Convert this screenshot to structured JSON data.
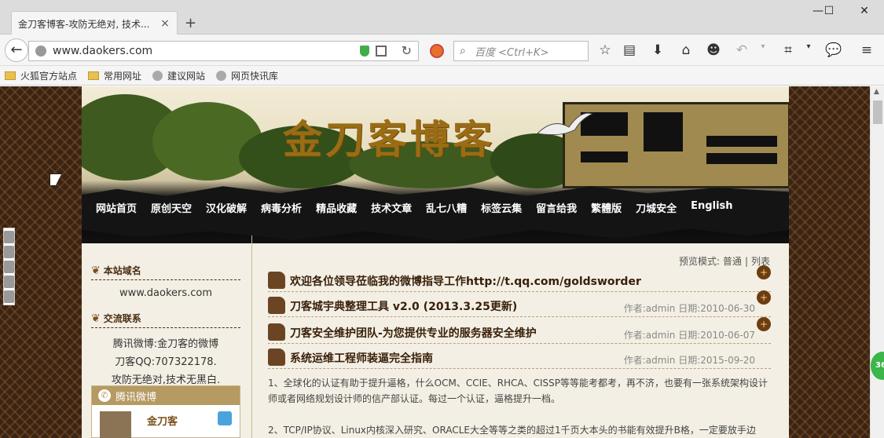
{
  "browser": {
    "tab_title": "金刀客博客-攻防无绝对, 技术...",
    "tab_close": "×",
    "new_tab": "+",
    "url": "www.daokers.com",
    "search_placeholder": "百度 <Ctrl+K>",
    "window_controls": {
      "minimize": "—",
      "maximize": "☐",
      "close": "✕"
    }
  },
  "bookmarks": [
    {
      "label": "火狐官方站点",
      "icon": "folder-icon"
    },
    {
      "label": "常用网址",
      "icon": "folder-icon"
    },
    {
      "label": "建议网站",
      "icon": "globe-icon"
    },
    {
      "label": "网页快讯库",
      "icon": "globe-icon"
    }
  ],
  "site": {
    "logo": "金刀客博客",
    "nav": [
      "网站首页",
      "原创天空",
      "汉化破解",
      "病毒分析",
      "精品收藏",
      "技术文章",
      "乱七八糟",
      "标签云集",
      "留言给我",
      "繁體版",
      "刀城安全",
      "English"
    ]
  },
  "sidebar": {
    "domain_head": "本站域名",
    "domain": "www.daokers.com",
    "contact_head": "交流联系",
    "contact_lines": [
      "腾讯微博:金刀客的微博",
      "刀客QQ:707322178.",
      "攻防无绝对,技术无黑白."
    ],
    "weibo_head": "腾讯微博",
    "weibo_name": "金刀客"
  },
  "main": {
    "mode_label": "预览模式:",
    "mode_normal": "普通",
    "mode_sep": "|",
    "mode_list": "列表",
    "posts": [
      {
        "title": "欢迎各位领导莅临我的微博指导工作http://t.qq.com/goldsworder",
        "meta": "",
        "badge": "+"
      },
      {
        "title": "刀客城宇典整理工具 v2.0 (2013.3.25更新)",
        "meta": "作者:admin 日期:2010-06-30",
        "badge": "+"
      },
      {
        "title": "刀客安全维护团队-为您提供专业的服务器安全维护",
        "meta": "作者:admin 日期:2010-06-07",
        "badge": "+"
      },
      {
        "title": "系统运维工程师装逼完全指南",
        "meta": "作者:admin 日期:2015-09-20",
        "badge": ""
      }
    ],
    "para1": "1、全球化的认证有助于提升逼格，什么OCM、CCIE、RHCA、CISSP等等能考都考，再不济，也要有一张系统架构设计师或者网络规划设计师的信产部认证。每过一个认证，逼格提升一档。",
    "para2": "2、TCP/IP协议、Linux内核深入研究、ORACLE大全等等之类的超过1千页大本头的书能有效提升B格，一定要放手边"
  },
  "colors": {
    "accent": "#6b4523",
    "frame": "#3b2414",
    "nav_text": "#ffffff"
  }
}
